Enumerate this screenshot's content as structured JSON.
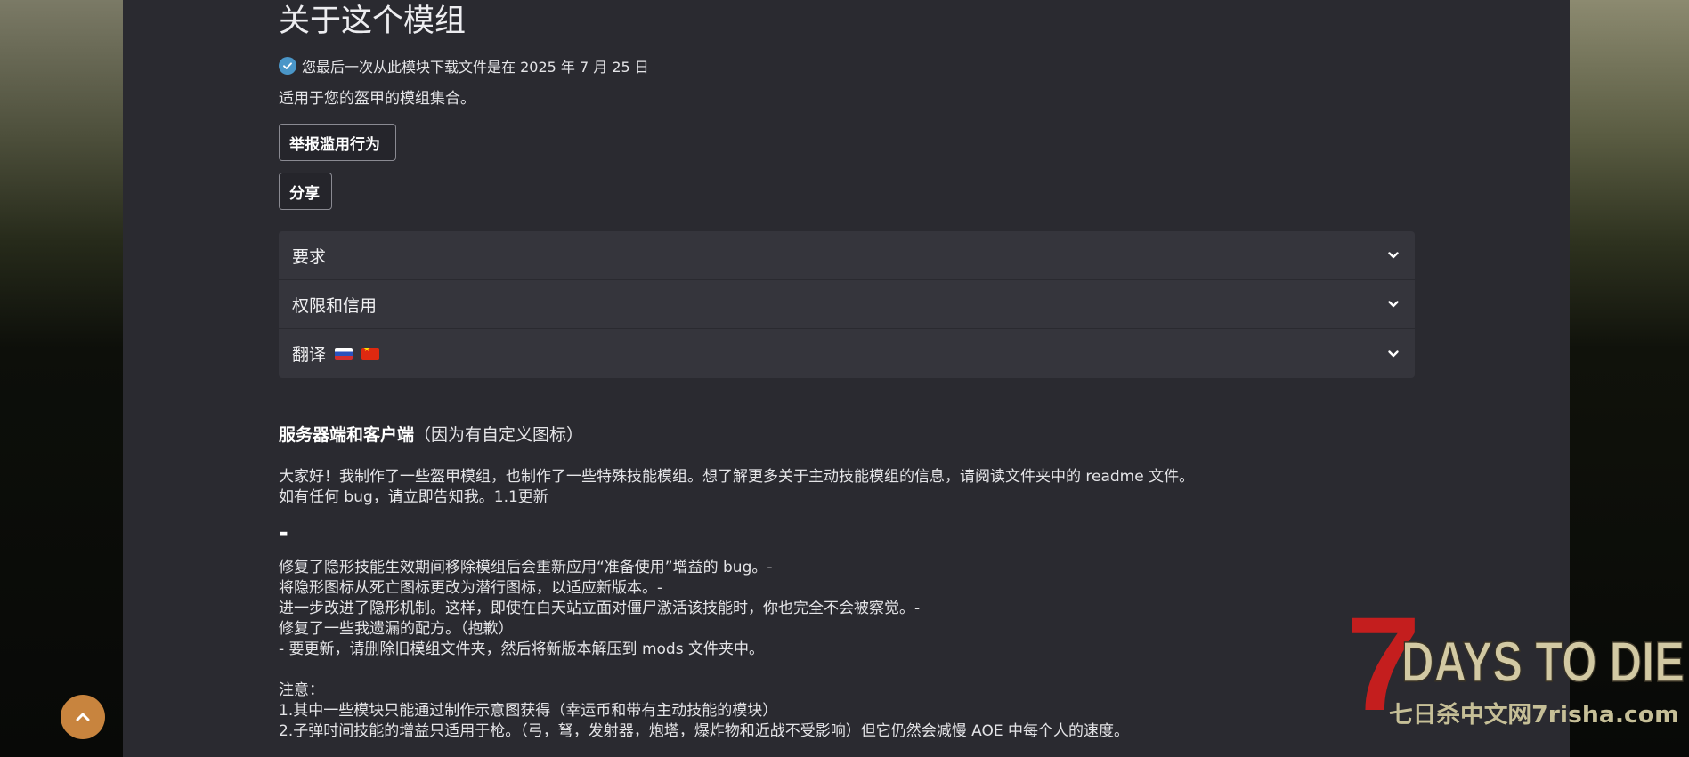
{
  "page": {
    "title": "关于这个模组",
    "download_note": "您最后一次从此模块下载文件是在 2025 年 7 月 25 日",
    "summary": "适用于您的盔甲的模组集合。"
  },
  "buttons": {
    "report": "举报滥用行为",
    "share": "分享"
  },
  "accordion": [
    {
      "label": "要求"
    },
    {
      "label": "权限和信用"
    },
    {
      "label": "翻译"
    }
  ],
  "icons": {
    "check": "check-circle-icon",
    "chevron": "chevron-down-icon",
    "flags": [
      "russia-flag-icon",
      "china-flag-icon"
    ],
    "scroll_top": "chevron-up-icon"
  },
  "colors": {
    "background": "#2a2a30",
    "accordion_bg": "#35353c",
    "check_blue": "#4a96c8",
    "scroll_button": "#c8843e"
  },
  "description": {
    "heading_bold": "服务器端和客户端",
    "heading_rest": "（因为有自定义图标）",
    "intro_1": "大家好！我制作了一些盔甲模组，也制作了一些特殊技能模组。想了解更多关于主动技能模组的信息，请阅读文件夹中的 readme 文件。",
    "intro_2": "如有任何 bug，请立即告知我。1.1更新",
    "dash": "-",
    "changes": [
      "修复了隐形技能生效期间移除模组后会重新应用“准备使用”增益的 bug。-",
      "将隐形图标从死亡图标更改为潜行图标，以适应新版本。-",
      "进一步改进了隐形机制。这样，即使在白天站立面对僵尸激活该技能时，你也完全不会被察觉。-",
      "修复了一些我遗漏的配方。（抱歉）",
      "- 要更新，请删除旧模组文件夹，然后将新版本解压到 mods 文件夹中。"
    ],
    "notes_title": "注意：",
    "notes": [
      "1.其中一些模块只能通过制作示意图获得（幸运币和带有主动技能的模块）",
      "2.子弹时间技能的增益只适用于枪。（弓，弩，发射器，炮塔，爆炸物和近战不受影响）但它仍然会减慢 AOE 中每个人的速度。"
    ]
  },
  "watermark": {
    "logo_number": "7",
    "logo_text": "DAYS TO DIE",
    "logo_sub": "七日杀中文网7risha.com"
  }
}
